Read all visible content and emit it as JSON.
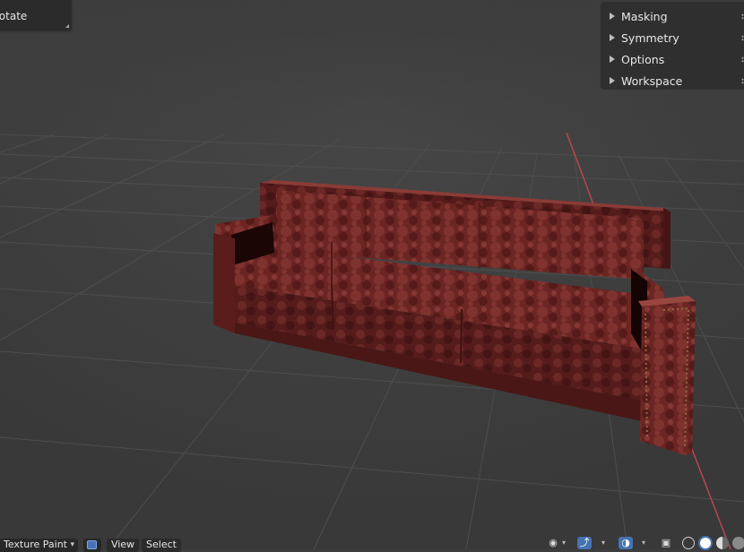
{
  "operator_panel": {
    "label": "Rotate"
  },
  "tool_settings_panel": {
    "items": [
      {
        "label": "Masking"
      },
      {
        "label": "Symmetry"
      },
      {
        "label": "Options"
      },
      {
        "label": "Workspace"
      }
    ]
  },
  "header": {
    "mode": "Texture Paint",
    "menus": {
      "view": "View",
      "select": "Select"
    },
    "icons": [
      "paint-mask-icon",
      "visibility-eye-icon",
      "gizmo-icon",
      "overlay-icon",
      "xray-icon",
      "wireframe-shading-icon",
      "solid-shading-icon",
      "material-preview-icon",
      "rendered-shading-icon"
    ]
  },
  "colors": {
    "viewport_bg": "#3d3d3d",
    "panel_bg": "#2f2f2f",
    "accent_blue": "#4772b3",
    "x_axis_red": "#c2474f",
    "sofa_leather": "#6e2624"
  }
}
